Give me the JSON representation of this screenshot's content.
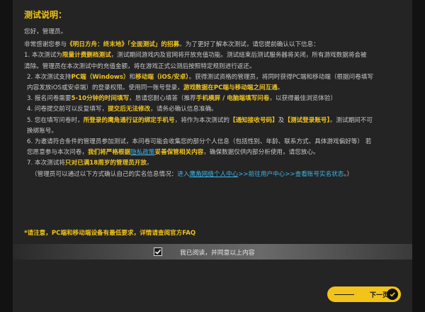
{
  "title": "测试说明：",
  "greeting": "您好，管理员。",
  "intro": {
    "a": "非常感谢您参与",
    "b": "《明日方舟：终末地》「全面测试」的招募",
    "c": "。为了更好了解本次测试，请您提前确认以下信息："
  },
  "item1": {
    "a": " 1. 本次测试为",
    "b": "限量计费删档测试",
    "c": "，测试期间游戏内及官网将开放充值功能。测试结束后测试服务器将关闭，所有游戏数据将会被",
    "d": "清除。管理员在本次测试中的充值金额，将在游戏正式公测后按照特定规则进行返还。"
  },
  "item2": {
    "a": "2. 本次测试支持",
    "b": "PC端（Windows）",
    "c": "和",
    "d": "移动端（iOS/安卓）",
    "e": "。获得测试资格的管理员，将同时获得PC端和移动端（根据问卷填写",
    "f": "内容发放iOS或安卓端）的登录权限。使用同一账号登录，",
    "g": "游戏数据在PC端与移动端之间互通",
    "h": "。"
  },
  "item3": {
    "a": "3. 报名问卷需要",
    "b": "5-10分钟的时间填写",
    "c": "，恳请您耐心填答（推荐",
    "d": "手机横屏 / 电脑端填写问卷",
    "e": "，以获得最佳浏览体验）"
  },
  "item4": {
    "a": "4. 问卷提交前可以反复填写，",
    "b": "提交后无法修改",
    "c": "，请务必确认信息准确。"
  },
  "item5": {
    "a": "5. 您在填写问卷时，",
    "b": "所登录的鹰角通行证的绑定手机号",
    "c": "，将作为本次测试的",
    "d": "【通知接收号码】",
    "e": "及",
    "f": "【测试登录账号】",
    "g": "。测试期间不可",
    "h": "换绑账号。"
  },
  "item6": {
    "a": "6. 为邀请符合条件的管理员参加测试，本问卷可能会收集您的部分个人信息（包括性别、年龄、联系方式、具体游戏偏好等） 若",
    "b": "您愿意参与本次问卷，",
    "c": "我们将严格根据",
    "d": "隐私政策",
    "e": "妥善保管相关内容",
    "f": "，确保数据仅供内部分析使用，请您放心。"
  },
  "item7": {
    "a": "7. 本次测试将",
    "b": "只对已满18周岁的管理员开放",
    "c": "。"
  },
  "realname": {
    "a": "（管理员可以通过以下方式确认自己的实名信息情况：",
    "b": "进入",
    "c": "鹰角网络个人中心",
    "d": ">>前往用户中心>>查看账号实名状态",
    "e": "。）"
  },
  "notice": "*请注意，PC端和移动端设备有最低要求，详情请查阅官方FAQ",
  "agree_label": "我已阅读，并同意以上内容",
  "agree_checked": true,
  "next_label": "下一页",
  "colors": {
    "accent": "#f2c318",
    "link": "#3fb6e8",
    "panel": "#242424"
  },
  "icons": {
    "checkbox": "check-icon",
    "next": "check-circle-icon"
  }
}
